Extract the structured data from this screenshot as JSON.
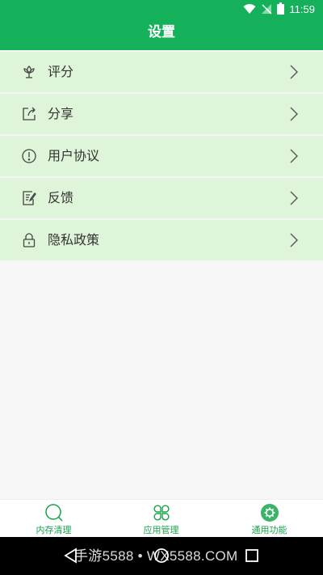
{
  "status_bar": {
    "time": "11:59",
    "icons": [
      "wifi-icon",
      "signal-off-icon",
      "battery-icon"
    ]
  },
  "header": {
    "title": "设置"
  },
  "settings": {
    "items": [
      {
        "label": "评分",
        "icon": "rating-flower-icon"
      },
      {
        "label": "分享",
        "icon": "share-icon"
      },
      {
        "label": "用户协议",
        "icon": "alert-circle-icon"
      },
      {
        "label": "反馈",
        "icon": "feedback-edit-icon"
      },
      {
        "label": "隐私政策",
        "icon": "lock-icon"
      }
    ]
  },
  "tabs": [
    {
      "label": "内存清理",
      "icon": "memory-clean-icon"
    },
    {
      "label": "应用管理",
      "icon": "app-manage-icon"
    },
    {
      "label": "通用功能",
      "icon": "general-gear-icon",
      "active": true
    }
  ],
  "watermark": "手游5588 • WX5588.COM",
  "colors": {
    "primary": "#15b05a",
    "row_bg": "#dff5d9",
    "tab_text": "#17a34a"
  }
}
